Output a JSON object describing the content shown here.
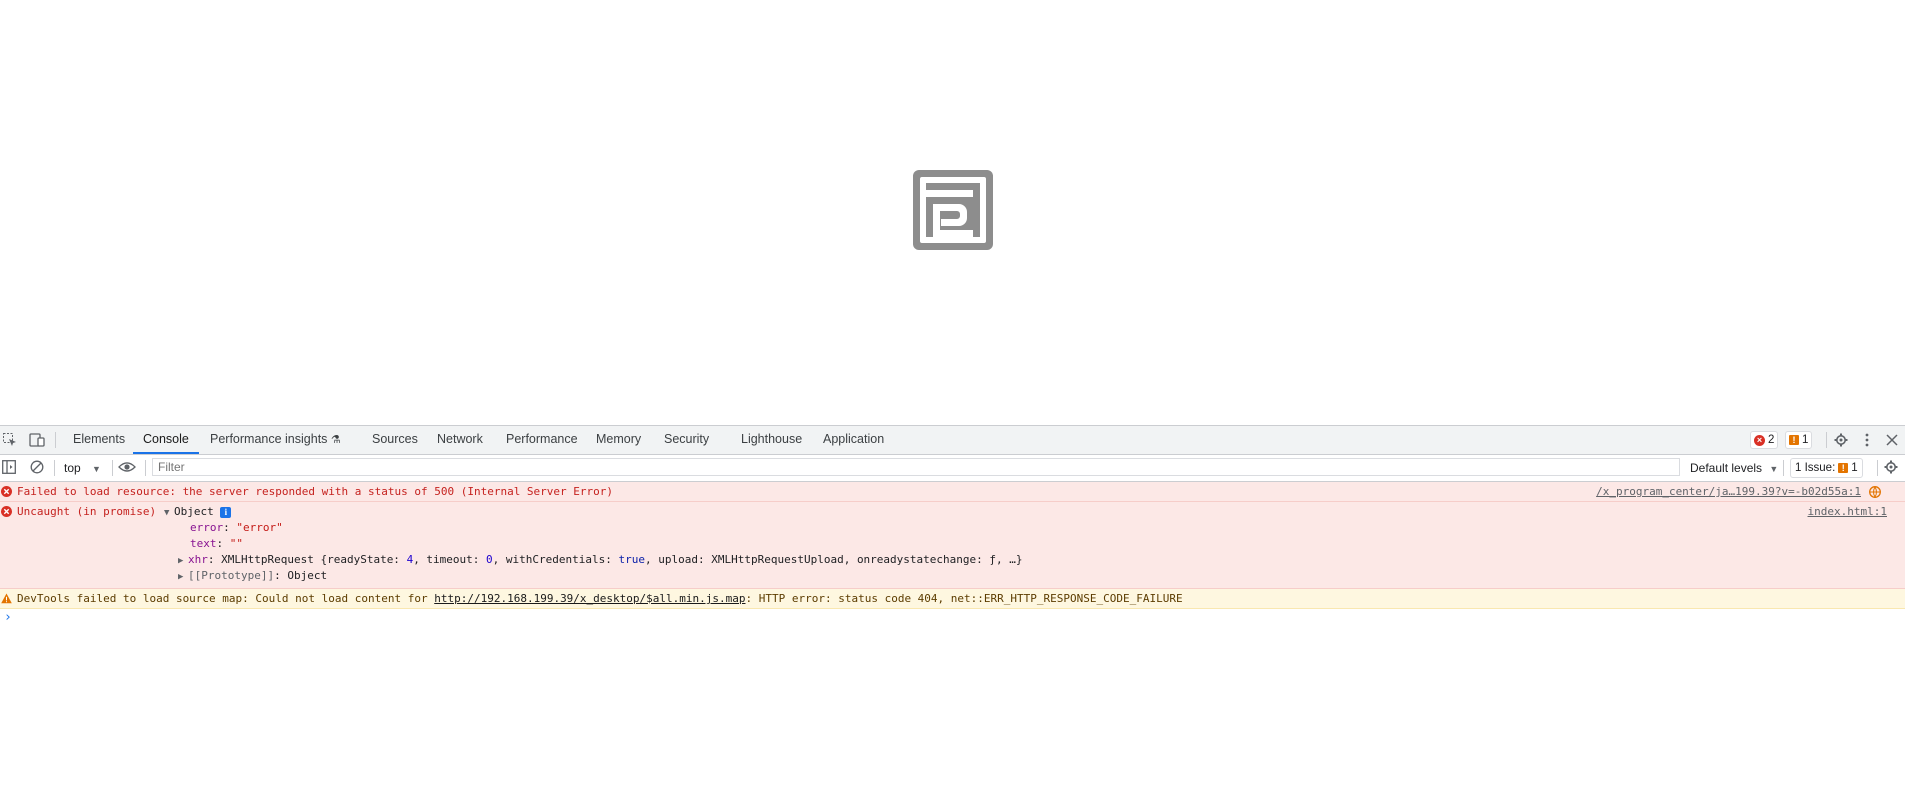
{
  "devtools": {
    "tabs": [
      "Elements",
      "Console",
      "Performance insights",
      "Sources",
      "Network",
      "Performance",
      "Memory",
      "Security",
      "Lighthouse",
      "Application"
    ],
    "active_tab": "Console",
    "error_count": "2",
    "warning_count": "1",
    "toolbar": {
      "context": "top",
      "filter_placeholder": "Filter",
      "levels": "Default levels",
      "issues_label": "1 Issue:",
      "issues_count": "1"
    }
  },
  "console": {
    "messages": [
      {
        "level": "error",
        "text": "Failed to load resource: the server responded with a status of 500 (Internal Server Error)",
        "source": "/x_program_center/ja…199.39?v=-b02d55a:1"
      },
      {
        "level": "error",
        "text": "Uncaught (in promise)",
        "object_label": "Object",
        "source": "index.html:1",
        "props": {
          "error_key": "error",
          "error_val": "\"error\"",
          "text_key": "text",
          "text_val": "\"\"",
          "xhr_key": "xhr",
          "xhr_type": "XMLHttpRequest {readyState: ",
          "xhr_rs": "4",
          "xhr_t": ", timeout: ",
          "xhr_tv": "0",
          "xhr_wc": ", withCredentials: ",
          "xhr_wcv": "true",
          "xhr_rest": ", upload: XMLHttpRequestUpload, onreadystatechange: ƒ, …}",
          "proto_key": "[[Prototype]]",
          "proto_val": "Object"
        }
      },
      {
        "level": "warning",
        "prefix": "DevTools failed to load source map: Could not load content for ",
        "link": "http://192.168.199.39/x_desktop/$all.min.js.map",
        "suffix": ": HTTP error: status code 404, net::ERR_HTTP_RESPONSE_CODE_FAILURE"
      }
    ],
    "prompt": "›"
  }
}
